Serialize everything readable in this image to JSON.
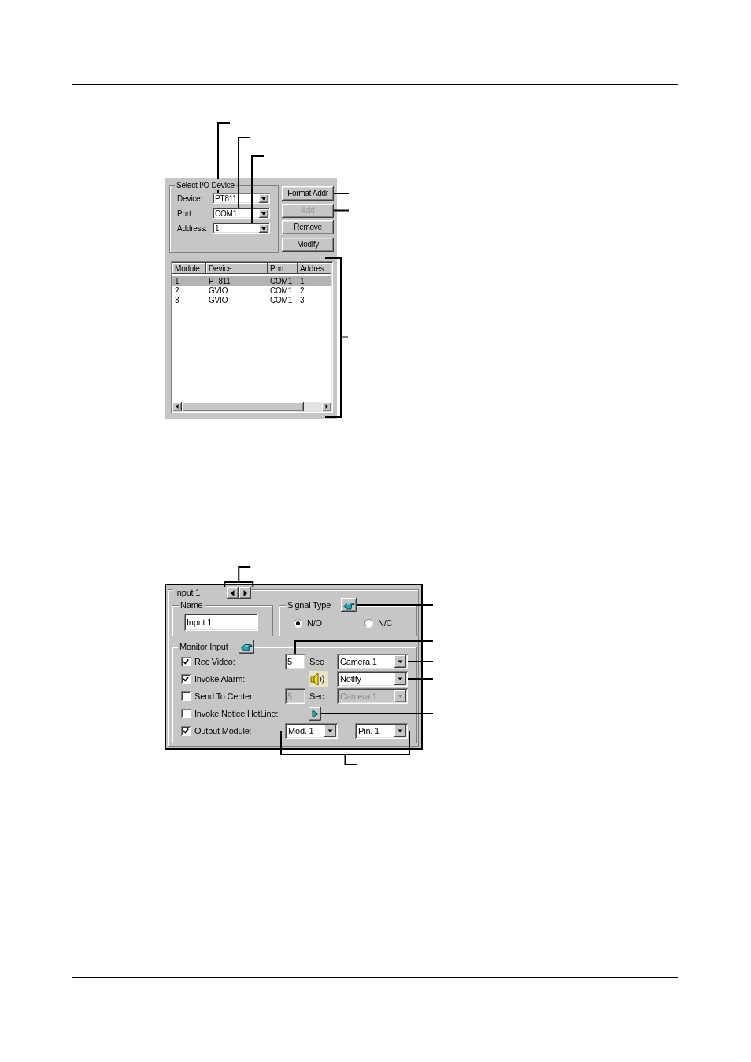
{
  "device_dialog": {
    "group_title": "Select I/O Device",
    "fields": [
      {
        "label": "Device:",
        "value": "PT811"
      },
      {
        "label": "Port:",
        "value": "COM1"
      },
      {
        "label": "Address:",
        "value": "1"
      }
    ],
    "buttons": [
      {
        "label": "Format Addr",
        "disabled": false
      },
      {
        "label": "Add",
        "disabled": true
      },
      {
        "label": "Remove",
        "disabled": false
      },
      {
        "label": "Modify",
        "disabled": false
      }
    ],
    "device_list": {
      "columns": [
        "Module",
        "Device",
        "Port",
        "Addres"
      ],
      "rows": [
        {
          "cells": [
            "1",
            "PT811",
            "COM1",
            "1"
          ],
          "selected": true
        },
        {
          "cells": [
            "2",
            "GVIO",
            "COM1",
            "2"
          ],
          "selected": false
        },
        {
          "cells": [
            "3",
            "GVIO",
            "COM1",
            "3"
          ],
          "selected": false
        }
      ]
    }
  },
  "input_dialog": {
    "title": "Input 1",
    "name_group": {
      "title": "Name",
      "value": "Input 1"
    },
    "signal_type": {
      "title": "Signal Type",
      "options": [
        {
          "label": "N/O",
          "selected": true
        },
        {
          "label": "N/C",
          "selected": false
        }
      ]
    },
    "monitor_input": {
      "title": "Monitor Input",
      "rows": [
        {
          "kind": "delay",
          "label": "Rec Video:",
          "checked": true,
          "disabled": false,
          "seconds": "5",
          "unit": "Sec",
          "choice": "Camera 1"
        },
        {
          "kind": "alarm",
          "label": "Invoke Alarm:",
          "checked": true,
          "disabled": false,
          "choice": "Notify"
        },
        {
          "kind": "delay",
          "label": "Send To Center:",
          "checked": false,
          "disabled": true,
          "seconds": "5",
          "unit": "Sec",
          "choice": "Camera 1"
        },
        {
          "kind": "hotline",
          "label": "Invoke Notice HotLine:",
          "checked": false,
          "disabled": false
        },
        {
          "kind": "output",
          "label": "Output Module:",
          "checked": true,
          "disabled": false,
          "choices": [
            "Mod. 1",
            "Pin. 1"
          ]
        }
      ]
    }
  }
}
